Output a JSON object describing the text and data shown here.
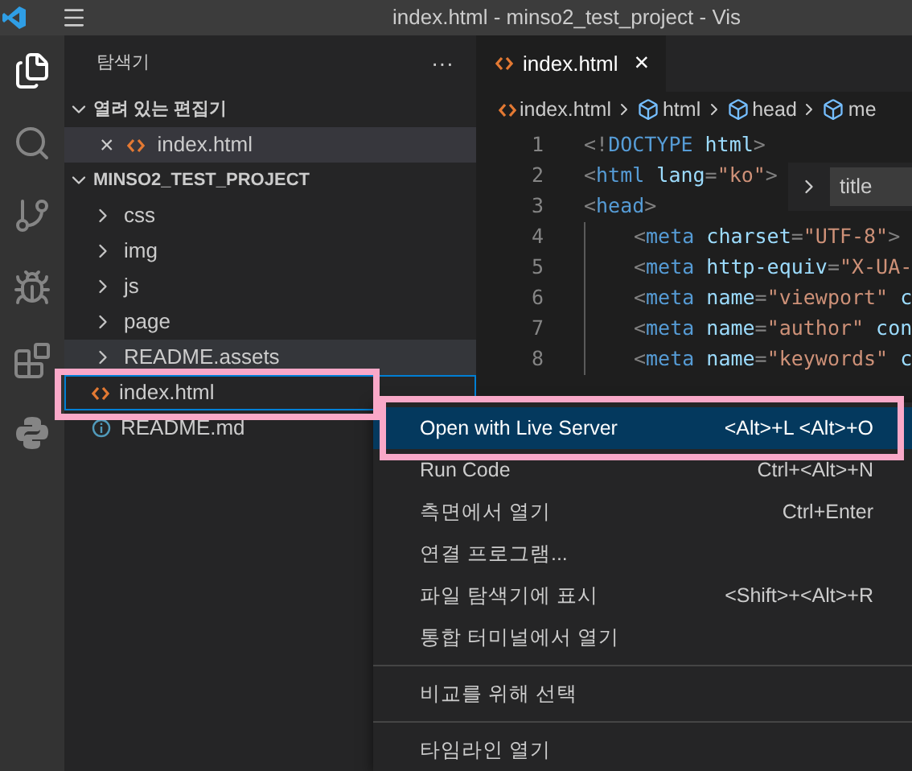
{
  "window": {
    "title": "index.html - minso2_test_project - Vis"
  },
  "sidebar": {
    "title": "탐색기",
    "more": "···",
    "open_editors": {
      "title": "열려 있는 편집기",
      "expanded": true,
      "items": [
        {
          "name": "index.html",
          "kind": "html",
          "close": "×",
          "selected": true
        }
      ]
    },
    "project": {
      "title": "MINSO2_TEST_PROJECT",
      "expanded": true,
      "items": [
        {
          "name": "css",
          "kind": "folder",
          "selected": false,
          "hovered": false,
          "annotated": false
        },
        {
          "name": "img",
          "kind": "folder",
          "selected": false,
          "hovered": false,
          "annotated": false
        },
        {
          "name": "js",
          "kind": "folder",
          "selected": false,
          "hovered": false,
          "annotated": false
        },
        {
          "name": "page",
          "kind": "folder",
          "selected": false,
          "hovered": false,
          "annotated": false
        },
        {
          "name": "README.assets",
          "kind": "folder",
          "selected": false,
          "hovered": true,
          "annotated": false
        },
        {
          "name": "index.html",
          "kind": "html",
          "selected": true,
          "hovered": false,
          "annotated": true
        },
        {
          "name": "README.md",
          "kind": "info",
          "selected": false,
          "hovered": false,
          "annotated": false
        }
      ]
    }
  },
  "tabs": [
    {
      "label": "index.html",
      "close": "×",
      "selected": true
    }
  ],
  "breadcrumbs": [
    {
      "label": "index.html",
      "kind": "file"
    },
    {
      "label": "html",
      "kind": "symbol"
    },
    {
      "label": "head",
      "kind": "symbol"
    },
    {
      "label": "me",
      "kind": "symbol"
    }
  ],
  "breadcrumb_popup": {
    "label": "title"
  },
  "code": [
    {
      "number": "1",
      "indent": false,
      "tokens": [
        {
          "kind": "punct",
          "text": "<!"
        },
        {
          "kind": "tag",
          "text": "DOCTYPE"
        },
        {
          "kind": "attr",
          "text": " html"
        },
        {
          "kind": "punct",
          "text": ">"
        }
      ]
    },
    {
      "number": "2",
      "indent": false,
      "tokens": [
        {
          "kind": "punct",
          "text": "<"
        },
        {
          "kind": "tag",
          "text": "html"
        },
        {
          "kind": "attr",
          "text": " lang"
        },
        {
          "kind": "punct",
          "text": "="
        },
        {
          "kind": "string",
          "text": "\"ko\""
        },
        {
          "kind": "punct",
          "text": ">"
        }
      ]
    },
    {
      "number": "3",
      "indent": false,
      "tokens": [
        {
          "kind": "punct",
          "text": "<"
        },
        {
          "kind": "tag",
          "text": "head"
        },
        {
          "kind": "punct",
          "text": ">"
        }
      ]
    },
    {
      "number": "4",
      "indent": true,
      "tokens": [
        {
          "kind": "punct",
          "text": "<"
        },
        {
          "kind": "tag",
          "text": "meta"
        },
        {
          "kind": "attr",
          "text": " charset"
        },
        {
          "kind": "punct",
          "text": "="
        },
        {
          "kind": "string",
          "text": "\"UTF-8\""
        },
        {
          "kind": "punct",
          "text": ">"
        }
      ]
    },
    {
      "number": "5",
      "indent": true,
      "tokens": [
        {
          "kind": "punct",
          "text": "<"
        },
        {
          "kind": "tag",
          "text": "meta"
        },
        {
          "kind": "attr",
          "text": " http-equiv"
        },
        {
          "kind": "punct",
          "text": "="
        },
        {
          "kind": "string",
          "text": "\"X-UA-"
        }
      ]
    },
    {
      "number": "6",
      "indent": true,
      "tokens": [
        {
          "kind": "punct",
          "text": "<"
        },
        {
          "kind": "tag",
          "text": "meta"
        },
        {
          "kind": "attr",
          "text": " name"
        },
        {
          "kind": "punct",
          "text": "="
        },
        {
          "kind": "string",
          "text": "\"viewport\""
        },
        {
          "kind": "attr",
          "text": " c"
        }
      ]
    },
    {
      "number": "7",
      "indent": true,
      "tokens": [
        {
          "kind": "punct",
          "text": "<"
        },
        {
          "kind": "tag",
          "text": "meta"
        },
        {
          "kind": "attr",
          "text": " name"
        },
        {
          "kind": "punct",
          "text": "="
        },
        {
          "kind": "string",
          "text": "\"author\""
        },
        {
          "kind": "attr",
          "text": " con"
        }
      ]
    },
    {
      "number": "8",
      "indent": true,
      "tokens": [
        {
          "kind": "punct",
          "text": "<"
        },
        {
          "kind": "tag",
          "text": "meta"
        },
        {
          "kind": "attr",
          "text": " name"
        },
        {
          "kind": "punct",
          "text": "="
        },
        {
          "kind": "string",
          "text": "\"keywords\""
        },
        {
          "kind": "attr",
          "text": " c"
        }
      ]
    }
  ],
  "context_menu": {
    "items": [
      {
        "kind": "item",
        "label": "Open with Live Server",
        "shortcut": "<Alt>+L <Alt>+O",
        "selected": true,
        "annotated": true
      },
      {
        "kind": "item",
        "label": "Run Code",
        "shortcut": "Ctrl+<Alt>+N",
        "selected": false,
        "annotated": false
      },
      {
        "kind": "item",
        "label": "측면에서 열기",
        "shortcut": "Ctrl+Enter",
        "selected": false,
        "annotated": false
      },
      {
        "kind": "item",
        "label": "연결 프로그램...",
        "selected": false,
        "annotated": false
      },
      {
        "kind": "item",
        "label": "파일 탐색기에 표시",
        "shortcut": "<Shift>+<Alt>+R",
        "selected": false,
        "annotated": false
      },
      {
        "kind": "item",
        "label": "통합 터미널에서 열기",
        "selected": false,
        "annotated": false
      },
      {
        "kind": "separator"
      },
      {
        "kind": "item",
        "label": "비교를 위해 선택",
        "selected": false,
        "annotated": false
      },
      {
        "kind": "separator"
      },
      {
        "kind": "item",
        "label": "타임라인 열기",
        "selected": false,
        "annotated": false
      }
    ]
  }
}
